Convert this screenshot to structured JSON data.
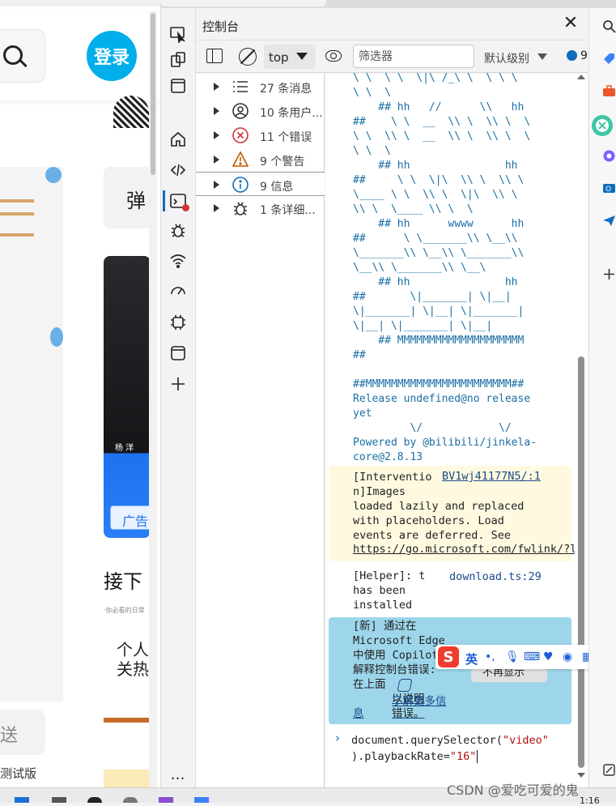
{
  "site": {
    "login_label": "登录",
    "danmu_label": "弹",
    "video_author": "杨 洋",
    "ad_label": "广告",
    "next_heading": "接下",
    "next_sub": "·你必看的日常",
    "card2_text": "个人\n关热",
    "send_label": "送",
    "beta_label": "测试版"
  },
  "devtools": {
    "title": "控制台",
    "close_icon": "close-icon",
    "toolbar": {
      "context": "top",
      "filter_placeholder": "筛选器",
      "levels": "默认级别",
      "issues_count": "9"
    },
    "sidebar": [
      {
        "label": "27 条消息",
        "icon": "list-icon"
      },
      {
        "label": "10 条用户...",
        "icon": "user-icon"
      },
      {
        "label": "11 个错误",
        "icon": "error-icon"
      },
      {
        "label": "9 个警告",
        "icon": "warning-icon"
      },
      {
        "label": "9 信息",
        "icon": "info-icon"
      },
      {
        "label": "1 条详细...",
        "icon": "bug-icon"
      }
    ],
    "console": {
      "ascii_art": "\\ \\  \\ \\  \\|\\ /_\\ \\  \\ \\ \\\n\\ \\  \\\n    ## hh   //      \\\\   hh\n##    \\ \\  __  \\\\ \\  \\\\ \\  \\\n\\ \\  \\\\ \\  __  \\\\ \\  \\\\ \\  \\\n\\ \\  \\\n    ## hh               hh\n##     \\ \\  \\|\\  \\\\ \\  \\\\ \\\n\\____ \\ \\  \\\\ \\  \\|\\  \\\\ \\\n\\\\ \\  \\____ \\\\ \\  \\\n    ## hh      wwww      hh\n##      \\ \\_______\\\\ \\__\\\\\n\\_______\\\\ \\__\\\\ \\_______\\\\\n\\__\\\\ \\_______\\\\ \\__\\\n    ## hh               hh\n##       \\|_______| \\|__|\n\\|_______| \\|__| \\|_______|\n\\|__| \\|_______| \\|__|\n    ## MMMMMMMMMMMMMMMMMMMM\n##\n\n##MMMMMMMMMMMMMMMMMMMMMMM##\nRelease undefined@no release\nyet\n         \\/            \\/\nPowered by @bilibili/jinkela-\ncore@2.8.13",
      "intervention_text": "[Interventio\nn]Images\nloaded lazily and replaced\nwith placeholders. Load\nevents are deferred. See",
      "intervention_source": "BV1wj41177N5/:1",
      "intervention_link": "https://go.microsoft.com/fwlink/?l",
      "helper_text": "[Helper]: t\nhas been\ninstalled",
      "helper_source": "download.ts:29",
      "copilot_text": "[新] 通过在\nMicrosoft Edge\n中使用 Copilot\n解释控制台错误:\n在上面",
      "copilot_link": "以说明\n错误。",
      "copilot_learn_more": "了解更多信",
      "copilot_tail": "息",
      "copilot_dismiss": "不再显示",
      "prompt_code_1": "document.querySelector(",
      "prompt_str_1": "\"video\"",
      "prompt_code_2": ").playbackRate=",
      "prompt_str_2": "\"16\""
    }
  },
  "ime": {
    "lang": "英"
  },
  "watermark": "CSDN @爱吃可爱的鬼",
  "taskbar_time": "1:16",
  "colors": {
    "accent": "#0f6cbd",
    "login": "#00aeec",
    "copilot_bg": "#9dd6ea",
    "warning_bg": "#fff9e0"
  }
}
